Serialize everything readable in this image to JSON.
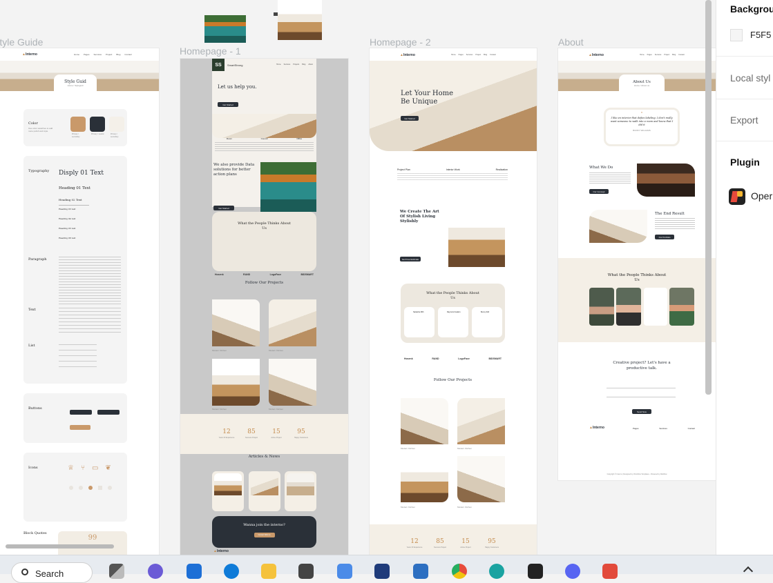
{
  "canvas": {
    "frames": [
      {
        "label": "Style Guide"
      },
      {
        "label": "Homepage - 1"
      },
      {
        "label": "Homepage - 2"
      },
      {
        "label": "About"
      }
    ]
  },
  "style_guide": {
    "header_title": "Style Guid",
    "header_sub": "Home / Styleguid",
    "color_title": "Color",
    "color_desc": "Use color swatches to add more polish and style",
    "swatches": [
      {
        "color": "#c9996a",
        "label": "Primary / secondary"
      },
      {
        "color": "#2a3038",
        "label": "Primary / neutral"
      },
      {
        "color": "#f4f0e9",
        "label": "Primary / secondary"
      }
    ],
    "typo_title": "Typography",
    "display_text": "Disply 01 Text",
    "heading1": "Heading 01 Text",
    "heading2": "Heading 02 Text",
    "heading3": "Heading 03 text",
    "heading4": "Heading 04 text",
    "heading5": "Heading 05 text",
    "heading6": "Heading 06 text",
    "paragraph_title": "Paragraph",
    "text_title": "Text",
    "list_title": "List",
    "buttons_title": "Buttons",
    "icons_title": "Icons",
    "block_quotes_title": "Block Quotes",
    "quote_mark": "99"
  },
  "home1": {
    "logo": "SS",
    "brand": "SmartStrong",
    "nav": [
      "Home",
      "Services",
      "Projects",
      "Blog",
      "About"
    ],
    "hero_title": "Let us help you.",
    "hero_btn": "Get Started",
    "features": [
      "Room",
      "Council",
      "Office"
    ],
    "section2_title": "We also provide Data solutions for better action plans",
    "section2_btn": "Get Started",
    "testimonial_title": "What the People Thinks About Us",
    "partners": [
      "Hosenk",
      "RAND",
      "LogoFace",
      "BIDSMART"
    ],
    "projects_title": "Follow Our Projects",
    "project_cards": [
      "Modern Kitchen",
      "Modern Kitchen",
      "Modern Kitchen",
      "Modern Kitchen"
    ],
    "stats": [
      {
        "n": "12",
        "l": "Years Of Experience"
      },
      {
        "n": "85",
        "l": "Success Project"
      },
      {
        "n": "15",
        "l": "Active Project"
      },
      {
        "n": "95",
        "l": "Happy Customers"
      }
    ],
    "articles_title": "Articles & News",
    "join_title": "Wanna join the interno?",
    "join_btn": "Contact With Us",
    "footer_logo": "Interno"
  },
  "home2": {
    "logo": "Interno",
    "nav": [
      "Home",
      "Pages",
      "Services",
      "Project",
      "Blog",
      "Contact"
    ],
    "hero_title": "Let Your Home Be Unique",
    "hero_btn": "Get Started",
    "features": [
      "Project Plan",
      "Interior Work",
      "Realization"
    ],
    "art_title": "We Create The Art Of Stylish Living Stylishly",
    "art_btn": "Get Free Estimate",
    "testimonial_title": "What the People Thinks About Us",
    "reviewers": [
      "Nattasha Mith",
      "Raymond Galario",
      "Benny Roll"
    ],
    "partners": [
      "Hosenk",
      "RAND",
      "LogoFace",
      "BIDSMART"
    ],
    "projects_title": "Follow Our Projects",
    "project_cards": [
      "Modern Kitchen",
      "Modern Kitchen",
      "Modern Kitchen",
      "Modern Kitchen"
    ],
    "stats": [
      {
        "n": "12",
        "l": "Years Of Experience"
      },
      {
        "n": "85",
        "l": "Success Project"
      },
      {
        "n": "15",
        "l": "Active Project"
      },
      {
        "n": "95",
        "l": "Happy Customers"
      }
    ]
  },
  "about": {
    "logo": "Interno",
    "nav": [
      "Home",
      "Pages",
      "Services",
      "Project",
      "Blog",
      "Contact"
    ],
    "header_title": "About Us",
    "header_sub": "Home / About us",
    "quote": "I like an interior that defies labeling. I don't really want someone to walk into a room and know that I did it",
    "quote_author": "BUNNY WILLIAMS",
    "whatwedo_title": "What We Do",
    "whatwedo_btn": "Our Concept",
    "endresult_title": "The End Result",
    "endresult_btn": "Our Portfolio",
    "people_title": "What the People Thinks About Us",
    "contact_title": "Creative project? Let's have a productive talk.",
    "contact_btn": "Send Now",
    "footer_logo": "Interno",
    "footer_cols": [
      "Pages",
      "Services",
      "Contact"
    ],
    "copyright": "Copyright © Interno | Designed by Victorflow Templates - Powered by Webflow"
  },
  "panel": {
    "background_label": "Backgrou",
    "background_hex": "F5F5",
    "local_styles": "Local styl",
    "export": "Export",
    "plugin": "Plugin",
    "plugin_item": "Oper"
  },
  "taskbar": {
    "search": "Search"
  }
}
